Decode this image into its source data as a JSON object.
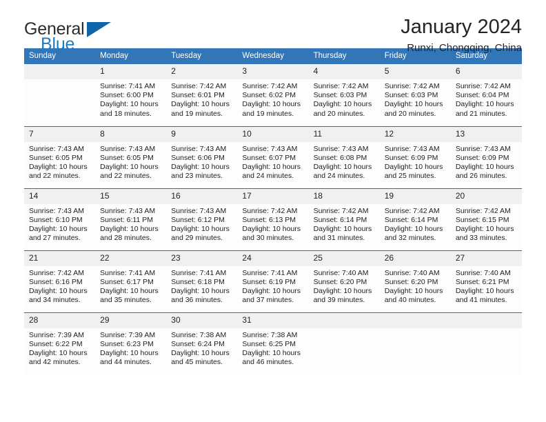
{
  "brand": {
    "name_top": "General",
    "name_bottom": "Blue",
    "color_dark": "#2b2b2b",
    "color_blue": "#1d7cc4",
    "triangle_color": "#1064a8"
  },
  "header": {
    "title": "January 2024",
    "subtitle": "Runxi, Chongqing, China"
  },
  "theme": {
    "header_bg": "#3376b8",
    "header_text": "#ffffff",
    "row_divider": "#2f6fa8",
    "daynum_bg": "#f0f0f0",
    "cell_bg": "#fdfdfd"
  },
  "weekdays": [
    "Sunday",
    "Monday",
    "Tuesday",
    "Wednesday",
    "Thursday",
    "Friday",
    "Saturday"
  ],
  "weeks": [
    [
      {
        "day": "",
        "sunrise": "",
        "sunset": "",
        "daylight1": "",
        "daylight2": ""
      },
      {
        "day": "1",
        "sunrise": "Sunrise: 7:41 AM",
        "sunset": "Sunset: 6:00 PM",
        "daylight1": "Daylight: 10 hours",
        "daylight2": "and 18 minutes."
      },
      {
        "day": "2",
        "sunrise": "Sunrise: 7:42 AM",
        "sunset": "Sunset: 6:01 PM",
        "daylight1": "Daylight: 10 hours",
        "daylight2": "and 19 minutes."
      },
      {
        "day": "3",
        "sunrise": "Sunrise: 7:42 AM",
        "sunset": "Sunset: 6:02 PM",
        "daylight1": "Daylight: 10 hours",
        "daylight2": "and 19 minutes."
      },
      {
        "day": "4",
        "sunrise": "Sunrise: 7:42 AM",
        "sunset": "Sunset: 6:03 PM",
        "daylight1": "Daylight: 10 hours",
        "daylight2": "and 20 minutes."
      },
      {
        "day": "5",
        "sunrise": "Sunrise: 7:42 AM",
        "sunset": "Sunset: 6:03 PM",
        "daylight1": "Daylight: 10 hours",
        "daylight2": "and 20 minutes."
      },
      {
        "day": "6",
        "sunrise": "Sunrise: 7:42 AM",
        "sunset": "Sunset: 6:04 PM",
        "daylight1": "Daylight: 10 hours",
        "daylight2": "and 21 minutes."
      }
    ],
    [
      {
        "day": "7",
        "sunrise": "Sunrise: 7:43 AM",
        "sunset": "Sunset: 6:05 PM",
        "daylight1": "Daylight: 10 hours",
        "daylight2": "and 22 minutes."
      },
      {
        "day": "8",
        "sunrise": "Sunrise: 7:43 AM",
        "sunset": "Sunset: 6:05 PM",
        "daylight1": "Daylight: 10 hours",
        "daylight2": "and 22 minutes."
      },
      {
        "day": "9",
        "sunrise": "Sunrise: 7:43 AM",
        "sunset": "Sunset: 6:06 PM",
        "daylight1": "Daylight: 10 hours",
        "daylight2": "and 23 minutes."
      },
      {
        "day": "10",
        "sunrise": "Sunrise: 7:43 AM",
        "sunset": "Sunset: 6:07 PM",
        "daylight1": "Daylight: 10 hours",
        "daylight2": "and 24 minutes."
      },
      {
        "day": "11",
        "sunrise": "Sunrise: 7:43 AM",
        "sunset": "Sunset: 6:08 PM",
        "daylight1": "Daylight: 10 hours",
        "daylight2": "and 24 minutes."
      },
      {
        "day": "12",
        "sunrise": "Sunrise: 7:43 AM",
        "sunset": "Sunset: 6:09 PM",
        "daylight1": "Daylight: 10 hours",
        "daylight2": "and 25 minutes."
      },
      {
        "day": "13",
        "sunrise": "Sunrise: 7:43 AM",
        "sunset": "Sunset: 6:09 PM",
        "daylight1": "Daylight: 10 hours",
        "daylight2": "and 26 minutes."
      }
    ],
    [
      {
        "day": "14",
        "sunrise": "Sunrise: 7:43 AM",
        "sunset": "Sunset: 6:10 PM",
        "daylight1": "Daylight: 10 hours",
        "daylight2": "and 27 minutes."
      },
      {
        "day": "15",
        "sunrise": "Sunrise: 7:43 AM",
        "sunset": "Sunset: 6:11 PM",
        "daylight1": "Daylight: 10 hours",
        "daylight2": "and 28 minutes."
      },
      {
        "day": "16",
        "sunrise": "Sunrise: 7:43 AM",
        "sunset": "Sunset: 6:12 PM",
        "daylight1": "Daylight: 10 hours",
        "daylight2": "and 29 minutes."
      },
      {
        "day": "17",
        "sunrise": "Sunrise: 7:42 AM",
        "sunset": "Sunset: 6:13 PM",
        "daylight1": "Daylight: 10 hours",
        "daylight2": "and 30 minutes."
      },
      {
        "day": "18",
        "sunrise": "Sunrise: 7:42 AM",
        "sunset": "Sunset: 6:14 PM",
        "daylight1": "Daylight: 10 hours",
        "daylight2": "and 31 minutes."
      },
      {
        "day": "19",
        "sunrise": "Sunrise: 7:42 AM",
        "sunset": "Sunset: 6:14 PM",
        "daylight1": "Daylight: 10 hours",
        "daylight2": "and 32 minutes."
      },
      {
        "day": "20",
        "sunrise": "Sunrise: 7:42 AM",
        "sunset": "Sunset: 6:15 PM",
        "daylight1": "Daylight: 10 hours",
        "daylight2": "and 33 minutes."
      }
    ],
    [
      {
        "day": "21",
        "sunrise": "Sunrise: 7:42 AM",
        "sunset": "Sunset: 6:16 PM",
        "daylight1": "Daylight: 10 hours",
        "daylight2": "and 34 minutes."
      },
      {
        "day": "22",
        "sunrise": "Sunrise: 7:41 AM",
        "sunset": "Sunset: 6:17 PM",
        "daylight1": "Daylight: 10 hours",
        "daylight2": "and 35 minutes."
      },
      {
        "day": "23",
        "sunrise": "Sunrise: 7:41 AM",
        "sunset": "Sunset: 6:18 PM",
        "daylight1": "Daylight: 10 hours",
        "daylight2": "and 36 minutes."
      },
      {
        "day": "24",
        "sunrise": "Sunrise: 7:41 AM",
        "sunset": "Sunset: 6:19 PM",
        "daylight1": "Daylight: 10 hours",
        "daylight2": "and 37 minutes."
      },
      {
        "day": "25",
        "sunrise": "Sunrise: 7:40 AM",
        "sunset": "Sunset: 6:20 PM",
        "daylight1": "Daylight: 10 hours",
        "daylight2": "and 39 minutes."
      },
      {
        "day": "26",
        "sunrise": "Sunrise: 7:40 AM",
        "sunset": "Sunset: 6:20 PM",
        "daylight1": "Daylight: 10 hours",
        "daylight2": "and 40 minutes."
      },
      {
        "day": "27",
        "sunrise": "Sunrise: 7:40 AM",
        "sunset": "Sunset: 6:21 PM",
        "daylight1": "Daylight: 10 hours",
        "daylight2": "and 41 minutes."
      }
    ],
    [
      {
        "day": "28",
        "sunrise": "Sunrise: 7:39 AM",
        "sunset": "Sunset: 6:22 PM",
        "daylight1": "Daylight: 10 hours",
        "daylight2": "and 42 minutes."
      },
      {
        "day": "29",
        "sunrise": "Sunrise: 7:39 AM",
        "sunset": "Sunset: 6:23 PM",
        "daylight1": "Daylight: 10 hours",
        "daylight2": "and 44 minutes."
      },
      {
        "day": "30",
        "sunrise": "Sunrise: 7:38 AM",
        "sunset": "Sunset: 6:24 PM",
        "daylight1": "Daylight: 10 hours",
        "daylight2": "and 45 minutes."
      },
      {
        "day": "31",
        "sunrise": "Sunrise: 7:38 AM",
        "sunset": "Sunset: 6:25 PM",
        "daylight1": "Daylight: 10 hours",
        "daylight2": "and 46 minutes."
      },
      {
        "day": "",
        "sunrise": "",
        "sunset": "",
        "daylight1": "",
        "daylight2": ""
      },
      {
        "day": "",
        "sunrise": "",
        "sunset": "",
        "daylight1": "",
        "daylight2": ""
      },
      {
        "day": "",
        "sunrise": "",
        "sunset": "",
        "daylight1": "",
        "daylight2": ""
      }
    ]
  ]
}
